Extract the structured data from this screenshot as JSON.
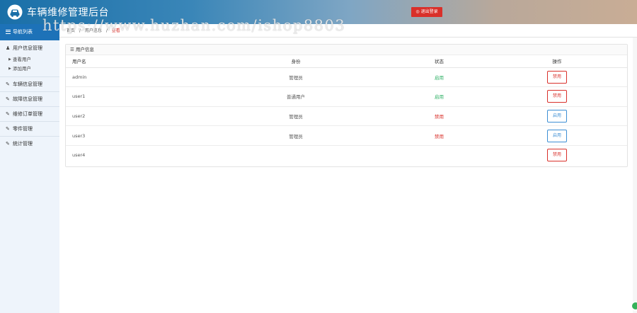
{
  "app": {
    "title": "车辆维修管理后台",
    "logout_label": "◎ 退出登录"
  },
  "watermark": "https://www.huzhan.com/ishop8803",
  "sidebar": {
    "home": "导航列表",
    "groups": [
      {
        "label": "用户信息管理",
        "icon": "user-icon",
        "children": [
          "查看用户",
          "添加用户"
        ]
      },
      {
        "label": "车辆信息管理",
        "icon": "edit-icon",
        "children": []
      },
      {
        "label": "故障信息管理",
        "icon": "edit-icon",
        "children": []
      },
      {
        "label": "维修订单管理",
        "icon": "edit-icon",
        "children": []
      },
      {
        "label": "零件管理",
        "icon": "edit-icon",
        "children": []
      },
      {
        "label": "统计管理",
        "icon": "edit-icon",
        "children": []
      }
    ]
  },
  "breadcrumb": {
    "items": [
      "首页",
      "用户信息",
      "查看"
    ],
    "separator": "/"
  },
  "panel": {
    "title": "☰ 用户信息",
    "columns": [
      "用户名",
      "身份",
      "状态",
      "操作"
    ],
    "rows": [
      {
        "name": "admin",
        "role": "管理员",
        "status": "启用",
        "status_type": "enabled",
        "action": "禁用",
        "action_color": "red"
      },
      {
        "name": "user1",
        "role": "普通用户",
        "status": "启用",
        "status_type": "enabled",
        "action": "禁用",
        "action_color": "red"
      },
      {
        "name": "user2",
        "role": "管理员",
        "status": "禁用",
        "status_type": "disabled",
        "action": "启用",
        "action_color": "blue"
      },
      {
        "name": "user3",
        "role": "管理员",
        "status": "禁用",
        "status_type": "disabled",
        "action": "启用",
        "action_color": "blue"
      },
      {
        "name": "user4",
        "role": "",
        "status": "",
        "status_type": "",
        "action": "禁用",
        "action_color": "red"
      }
    ]
  },
  "colors": {
    "accent": "#1d72b8",
    "danger": "#d9302a",
    "success": "#2fb066",
    "info": "#3d8fd4"
  }
}
